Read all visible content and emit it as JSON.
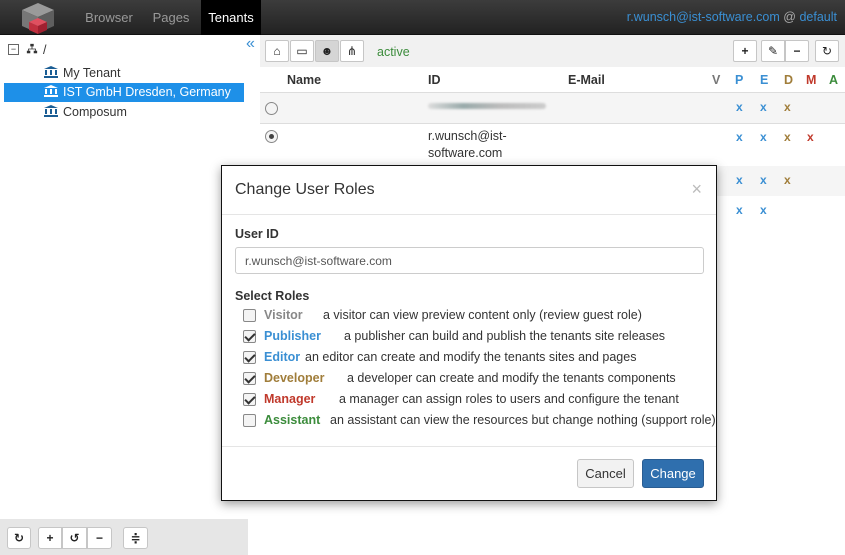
{
  "nav": {
    "tabs": [
      "Browser",
      "Pages",
      "Tenants"
    ],
    "active_tab": "Tenants",
    "user": "r.wunsch@ist-software.com",
    "at": "@",
    "workspace": "default"
  },
  "tree": {
    "root": "/",
    "items": [
      "My Tenant",
      "IST GmbH Dresden, Germany",
      "Composum"
    ],
    "selected": "IST GmbH Dresden, Germany"
  },
  "toolbar": {
    "filter_label": "active"
  },
  "table": {
    "headers": {
      "name": "Name",
      "id": "ID",
      "email": "E-Mail",
      "v": "V",
      "p": "P",
      "e": "E",
      "d": "D",
      "m": "M",
      "a": "A"
    },
    "rows": [
      {
        "id": "",
        "marks": [
          "x",
          "x",
          "x"
        ]
      },
      {
        "id": "r.wunsch@ist-software.com",
        "id_line1": "r.wunsch@ist-",
        "id_line2": "software.com",
        "marks": [
          "x",
          "x",
          "x",
          "x"
        ]
      },
      {
        "marks": [
          "x",
          "x",
          "x"
        ]
      },
      {
        "marks": [
          "x",
          "x"
        ]
      }
    ]
  },
  "modal": {
    "title": "Change User Roles",
    "close": "×",
    "user_id_label": "User ID",
    "user_id_value": "r.wunsch@ist-software.com",
    "roles_label": "Select Roles",
    "roles": [
      {
        "name": "Visitor",
        "desc": "a visitor can view preview content only (review guest role)",
        "checked": false,
        "color": "#888888"
      },
      {
        "name": "Publisher",
        "desc": "a publisher can build and publish the tenants site releases",
        "checked": true,
        "color": "#3a8fd3"
      },
      {
        "name": "Editor",
        "desc": "an editor can create and modify the tenants sites and pages",
        "checked": true,
        "color": "#3a8fd3"
      },
      {
        "name": "Developer",
        "desc": "a developer can create and modify the tenants components",
        "checked": true,
        "color": "#a07d3a"
      },
      {
        "name": "Manager",
        "desc": "a manager can assign roles to users and configure the tenant",
        "checked": true,
        "color": "#c0392b"
      },
      {
        "name": "Assistant",
        "desc": "an assistant can view the resources but change nothing (support role)",
        "checked": false,
        "color": "#3c8c3c"
      }
    ],
    "cancel_label": "Cancel",
    "change_label": "Change"
  }
}
